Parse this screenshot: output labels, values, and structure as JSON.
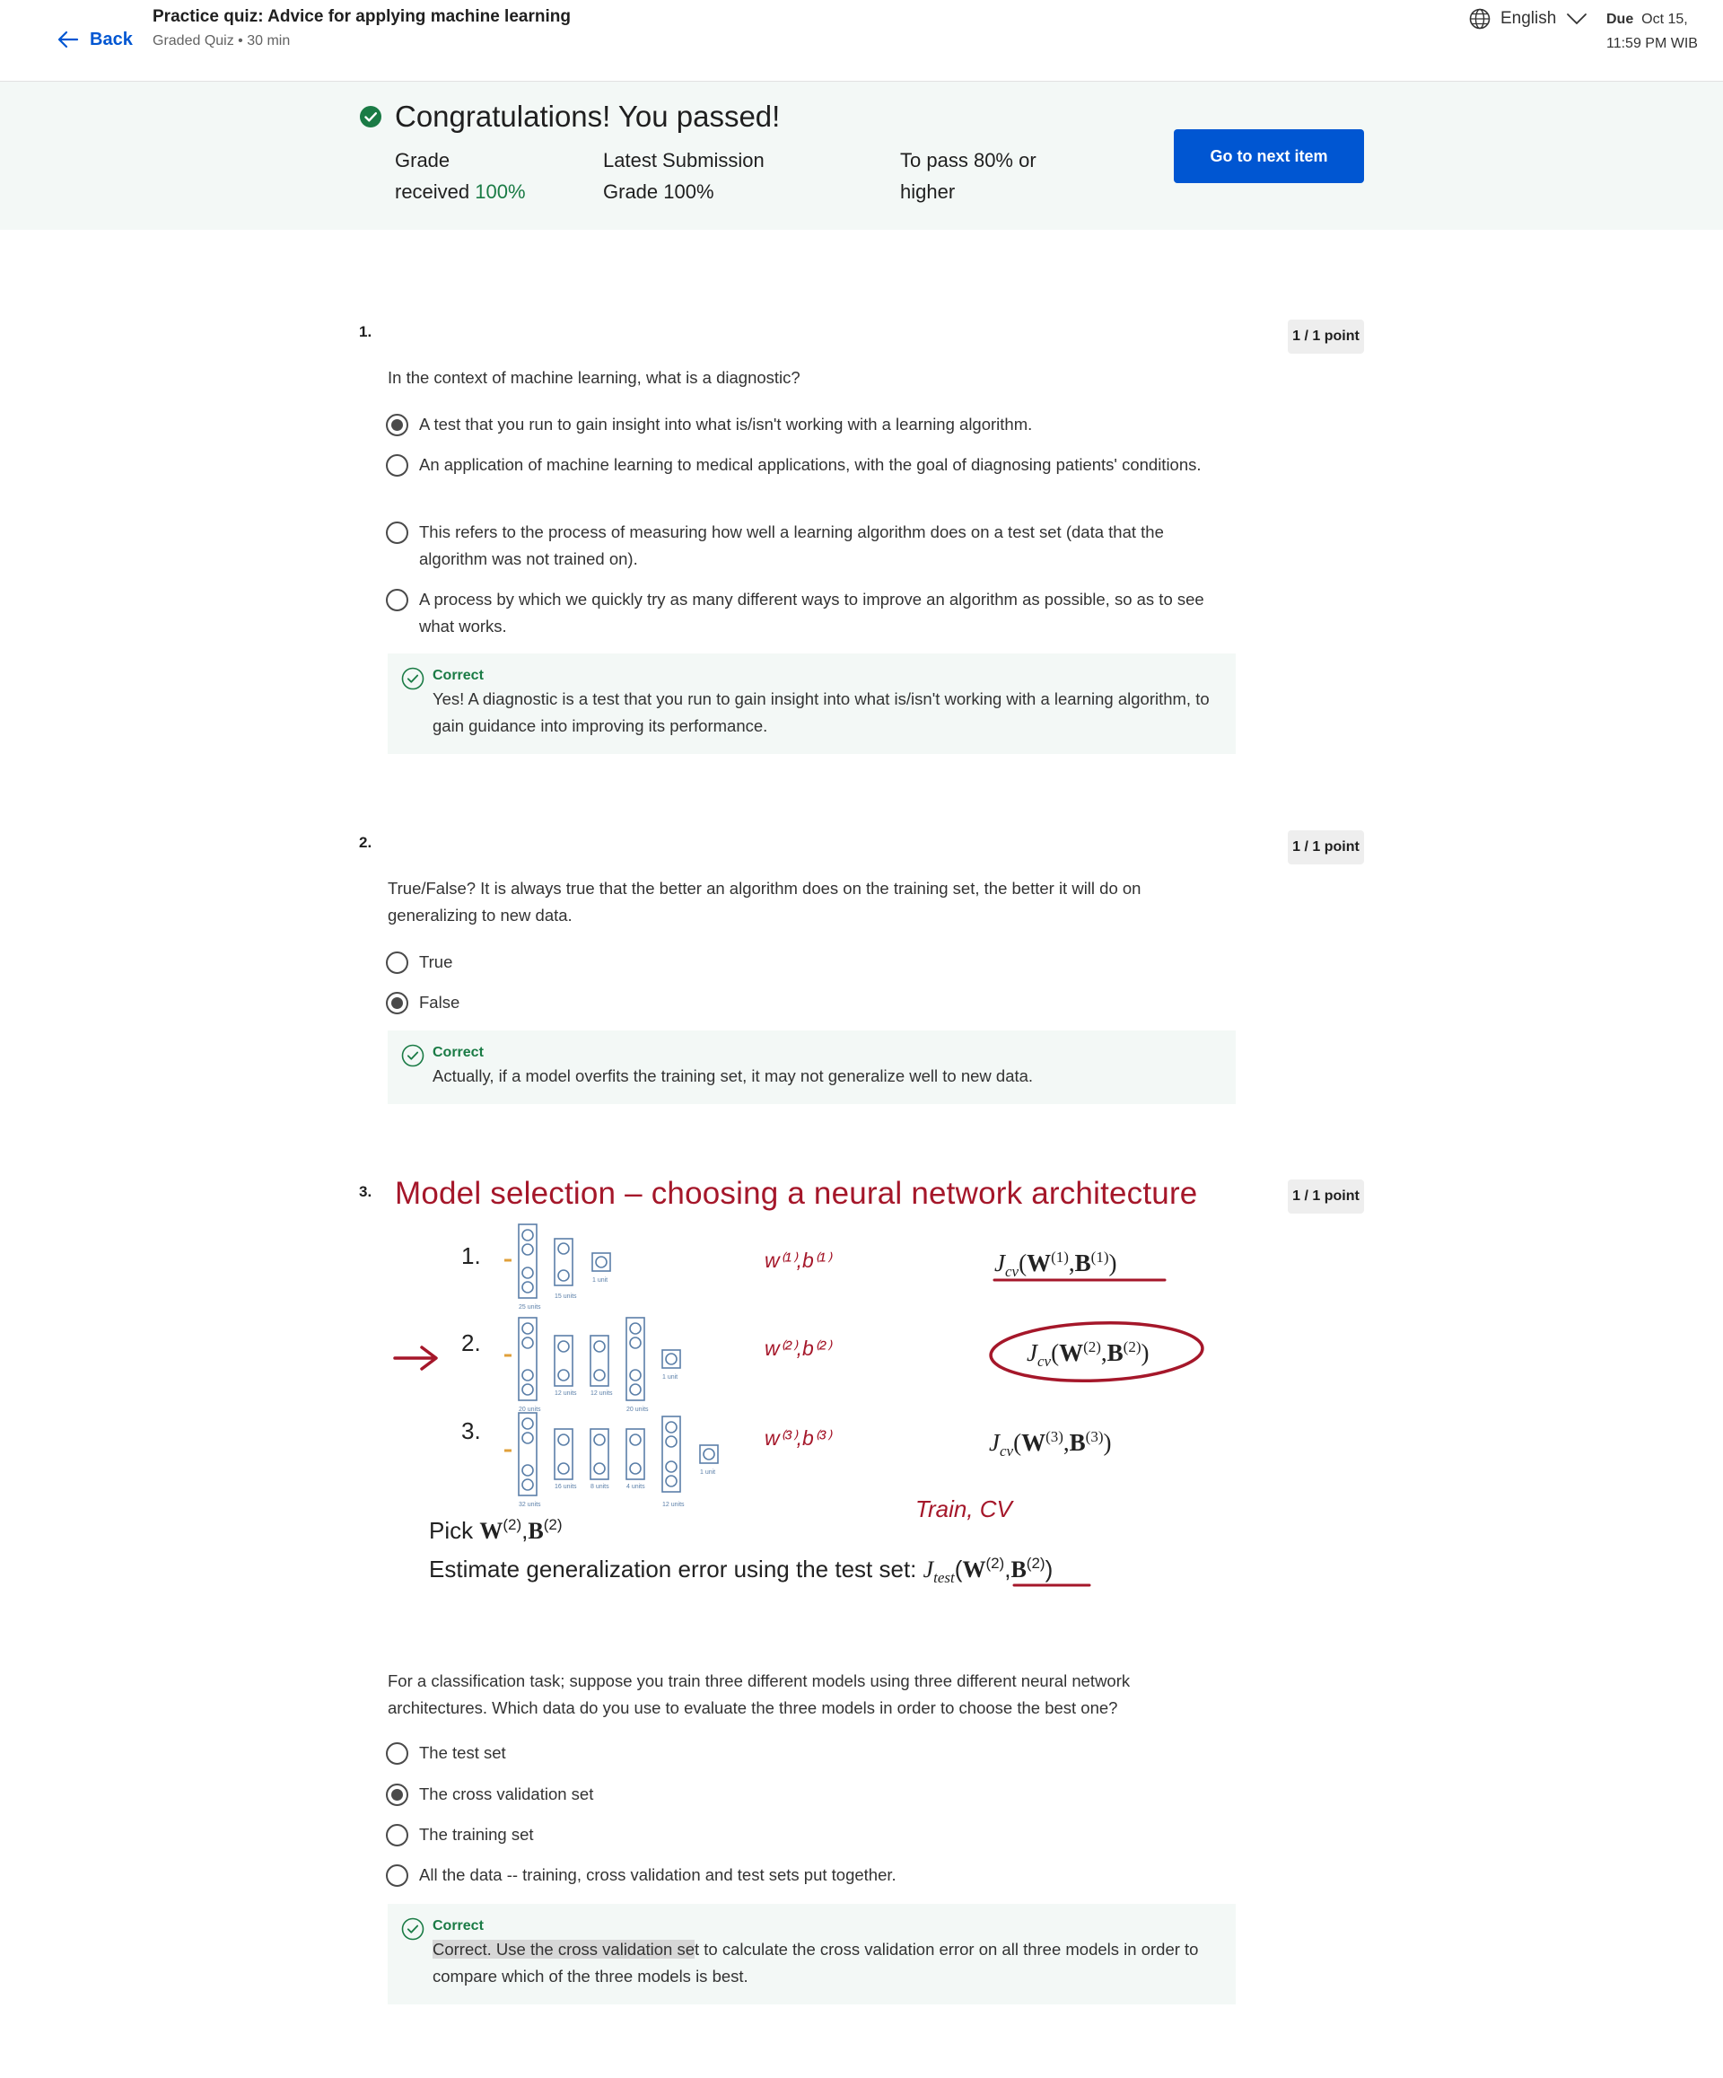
{
  "header": {
    "back_label": "Back",
    "title": "Practice quiz: Advice for applying machine learning",
    "meta": "Graded Quiz • 30 min",
    "language": "English",
    "due_label": "Due",
    "due_date": "Oct 15,",
    "due_time": "11:59 PM WIB"
  },
  "banner": {
    "title": "Congratulations! You passed!",
    "grade_label_1": "Grade",
    "grade_label_2": "received",
    "grade_value": "100%",
    "latest_label_1": "Latest Submission",
    "latest_label_2": "Grade",
    "latest_value": "100%",
    "pass_label_1": "To pass",
    "pass_value": "80% or",
    "pass_label_2": "higher",
    "next_button": "Go to next item"
  },
  "questions": [
    {
      "number": "1.",
      "points": "1 / 1 point",
      "text": "In the context of machine learning, what is a diagnostic?",
      "options": [
        "A test that you run to gain insight into what is/isn't working with a learning algorithm.",
        "An application of machine learning to medical applications, with the goal of diagnosing patients' conditions.",
        "This refers to the process of measuring how well a learning algorithm does on a test set (data that the algorithm was not trained on).",
        "A process by which we quickly try as many different ways to improve an algorithm as possible, so as to see what works."
      ],
      "selected": 0,
      "feedback_head": "Correct",
      "feedback_text": "Yes! A diagnostic is a test that you run to gain insight into what is/isn't working with a learning algorithm, to gain guidance into improving its performance."
    },
    {
      "number": "2.",
      "points": "1 / 1 point",
      "text": "True/False? It is always true that the better an algorithm does on the training set, the better it will do on generalizing to new data.",
      "options": [
        "True",
        "False"
      ],
      "selected": 1,
      "feedback_head": "Correct",
      "feedback_text": "Actually, if a model overfits the training set, it may not generalize well to new data."
    },
    {
      "number": "3.",
      "points": "1 / 1 point",
      "slide": {
        "title": "Model selection – choosing a neural network architecture",
        "rows": [
          {
            "label": "1.",
            "params": "w(1), b(1)",
            "cost": "Jcv(W(1), B(1))",
            "units": [
              "25 units",
              "15 units",
              "1 unit"
            ]
          },
          {
            "label": "2.",
            "params": "w(2), b(2)",
            "cost": "Jcv(W(2), B(2))",
            "units": [
              "20 units",
              "12 units",
              "12 units",
              "20 units",
              "1 unit"
            ]
          },
          {
            "label": "3.",
            "params": "w(3), b(3)",
            "cost": "Jcv(W(3), B(3))",
            "units": [
              "32 units",
              "16 units",
              "8 units",
              "4 units",
              "12 units",
              "1 unit"
            ]
          }
        ],
        "train_cv": "Train, CV",
        "pick": "Pick W(2), B(2)",
        "estimate": "Estimate generalization error using the test set: Jtest(W(2), B(2))"
      },
      "text": "For a classification task; suppose you train three different models using three different neural network architectures. Which data do you use to evaluate the three models in order to choose the best one?",
      "options": [
        "The test set",
        "The cross validation set",
        "The training set",
        "All the data -- training, cross validation and test sets put together."
      ],
      "selected": 1,
      "feedback_head": "Correct",
      "feedback_text_highlight": "Correct. Use the cross validation se",
      "feedback_text_rest": "t to calculate the cross validation error on all three models in order to compare which of the three models is best."
    }
  ],
  "colors": {
    "brand_blue": "#0056d2",
    "success_green": "#1a7b45",
    "slide_red": "#a5172a",
    "banner_bg": "#f3f8f6"
  },
  "icons": {
    "back": "arrow-left-icon",
    "language": "globe-icon",
    "language_dropdown": "chevron-down-icon",
    "passed": "check-circle-icon",
    "correct": "check-circle-outline-icon"
  }
}
